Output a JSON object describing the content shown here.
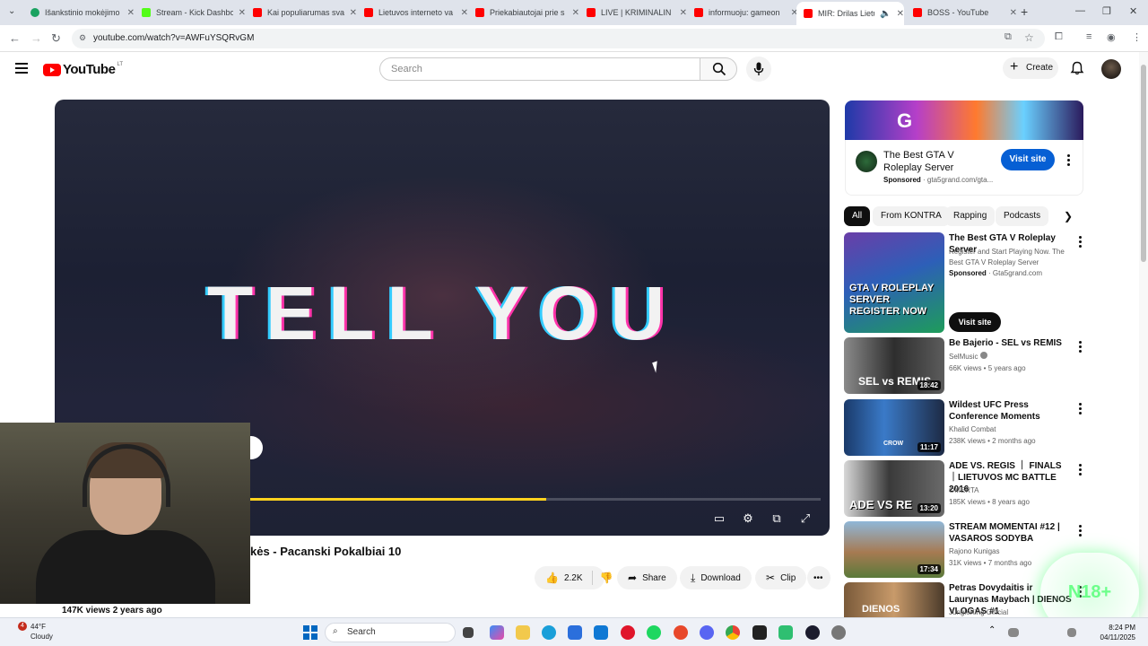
{
  "browser": {
    "tabs": [
      {
        "label": "Išankstinio mokėjimo",
        "color": "#1aa260"
      },
      {
        "label": "Stream - Kick Dashboard",
        "color": "#53fc18"
      },
      {
        "label": "Kai populiarumas sva",
        "color": "#ff0000"
      },
      {
        "label": "Lietuvos interneto va",
        "color": "#ff0000"
      },
      {
        "label": "Priekabiautojai prie s",
        "color": "#ff0000"
      },
      {
        "label": "LIVE | KRIMINALIN",
        "color": "#ff0000"
      },
      {
        "label": "informuoju: gameon",
        "color": "#ff0000"
      },
      {
        "label": "MIR: Drilas Lietu",
        "color": "#ff0000"
      },
      {
        "label": "BOSS - YouTube",
        "color": "#ff0000"
      }
    ],
    "url": "youtube.com/watch?v=AWFuYSQRvGM"
  },
  "header": {
    "logo_text": "YouTube",
    "region": "LT",
    "search_placeholder": "Search",
    "create_label": "Create"
  },
  "player": {
    "overlay_text": "TELL YOU",
    "progress": 0.52
  },
  "video": {
    "title": "kės - Pacanski Pokalbiai 10",
    "likes": "2.2K",
    "share": "Share",
    "download": "Download",
    "clip": "Clip",
    "views": "147K views  2 years ago"
  },
  "ad": {
    "title": "The Best GTA V Roleplay Server",
    "sponsored": "Sponsored",
    "domain": "gta5grand.com/gta...",
    "visit": "Visit site"
  },
  "chips": [
    "All",
    "From KONTRA",
    "Rapping",
    "Podcasts"
  ],
  "recs": [
    {
      "title": "The Best GTA V Roleplay Server",
      "channel": "Register and Start Playing Now. The Best GTA V Roleplay Server",
      "meta": "Gta5grand.com",
      "sponsored": "Sponsored",
      "visit": "Visit site",
      "duration": "",
      "thumb_text": "GTA V ROLEPLAY SERVER REGISTER NOW"
    },
    {
      "title": "Be Bajerio - SEL vs REMIS",
      "channel": "SelMusic",
      "meta": "66K views • 5 years ago",
      "duration": "18:42",
      "thumb_text": "SEL vs REMIS"
    },
    {
      "title": "Wildest UFC Press Conference Moments",
      "channel": "Khalid Combat",
      "meta": "238K views • 2 months ago",
      "duration": "11:17",
      "thumb_text": "CROW"
    },
    {
      "title": "ADE VS. REGIS ｜ FINALS ｜LIETUVOS MC BATTLE 2016",
      "channel": "OMERTA",
      "meta": "185K views • 8 years ago",
      "duration": "13:20",
      "thumb_text": "ADE VS RE"
    },
    {
      "title": "STREAM MOMENTAI #12 | VASAROS SODYBA",
      "channel": "Rajono Kunigas",
      "meta": "31K views • 7 months ago",
      "duration": "17:34",
      "thumb_text": ""
    },
    {
      "title": "Petras Dovydaitis ir Laurynas Maybach | DIENOS VLOGAS #1",
      "channel": "JungleKing Official",
      "meta": "",
      "duration": "",
      "thumb_text": "DIENOS"
    }
  ],
  "overlay_badge": "N18+",
  "taskbar": {
    "weather_temp": "44°F",
    "weather_desc": "Cloudy",
    "notif_count": "4",
    "search": "Search",
    "time": "8:24 PM",
    "date": "04/11/2025"
  }
}
